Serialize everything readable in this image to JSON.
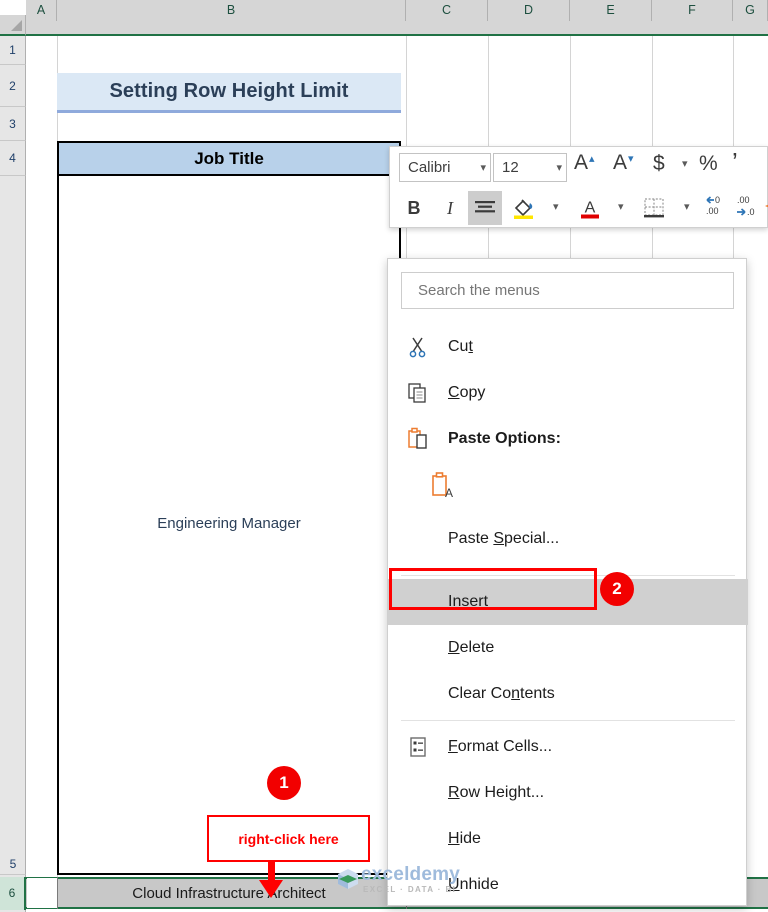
{
  "spreadsheet": {
    "column_headers": [
      "A",
      "B",
      "C",
      "D",
      "E",
      "F",
      "G"
    ],
    "row_headers": [
      "1",
      "2",
      "3",
      "4",
      "5",
      "6"
    ],
    "title_cell": "Setting Row Height Limit",
    "header_cell": "Job Title",
    "merged_cell_text": "Engineering Manager",
    "row6_cell_text": "Cloud Infrastructure Architect",
    "selected_row": "6"
  },
  "mini_toolbar": {
    "font_name": "Calibri",
    "font_size": "12",
    "controls": [
      {
        "name": "increase-font-size",
        "glyph": "A"
      },
      {
        "name": "decrease-font-size",
        "glyph": "A"
      },
      {
        "name": "accounting-number-format",
        "glyph": "$"
      },
      {
        "name": "percent-style",
        "glyph": "%"
      },
      {
        "name": "comma-style",
        "glyph": ","
      },
      {
        "name": "bold",
        "glyph": "B"
      },
      {
        "name": "italic",
        "glyph": "I"
      },
      {
        "name": "center-align",
        "glyph": "≡"
      },
      {
        "name": "fill-color",
        "glyph": "fill"
      },
      {
        "name": "font-color",
        "glyph": "A"
      },
      {
        "name": "borders",
        "glyph": "borders"
      },
      {
        "name": "decrease-decimal",
        "glyph": ".00"
      },
      {
        "name": "increase-decimal",
        "glyph": ".0"
      },
      {
        "name": "format-painter",
        "glyph": "brush"
      }
    ]
  },
  "context_menu": {
    "search_placeholder": "Search the menus",
    "items": [
      {
        "label": "Cut",
        "icon": "scissors-icon",
        "accel": "t",
        "bold": false,
        "highlighted": false
      },
      {
        "label": "Copy",
        "icon": "copy-icon",
        "accel": "C",
        "bold": false,
        "highlighted": false
      },
      {
        "label": "Paste Options:",
        "icon": "clipboard-icon",
        "accel": "",
        "bold": true,
        "highlighted": false
      },
      {
        "label": "",
        "icon": "paste-values-icon",
        "accel": "",
        "bold": false,
        "highlighted": false
      },
      {
        "label": "Paste Special...",
        "icon": "",
        "accel": "S",
        "bold": false,
        "highlighted": false
      },
      {
        "label": "Insert",
        "icon": "",
        "accel": "I",
        "bold": false,
        "highlighted": true
      },
      {
        "label": "Delete",
        "icon": "",
        "accel": "D",
        "bold": false,
        "highlighted": false
      },
      {
        "label": "Clear Contents",
        "icon": "",
        "accel": "n",
        "bold": false,
        "highlighted": false
      },
      {
        "label": "Format Cells...",
        "icon": "format-cells-icon",
        "accel": "F",
        "bold": false,
        "highlighted": false
      },
      {
        "label": "Row Height...",
        "icon": "",
        "accel": "R",
        "bold": false,
        "highlighted": false
      },
      {
        "label": "Hide",
        "icon": "",
        "accel": "H",
        "bold": false,
        "highlighted": false
      },
      {
        "label": "Unhide",
        "icon": "",
        "accel": "U",
        "bold": false,
        "highlighted": false
      }
    ]
  },
  "annotations": {
    "callout_text": "right-click here",
    "badge_1": "1",
    "badge_2": "2",
    "accent_red": "#f20000"
  },
  "watermark": {
    "main": "exceldemy",
    "sub": "EXCEL · DATA · BI"
  }
}
